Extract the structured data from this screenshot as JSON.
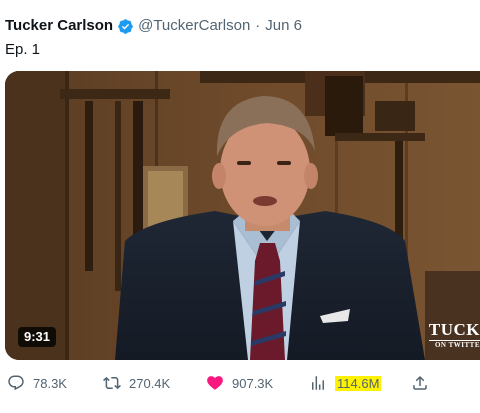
{
  "tweet": {
    "author_name": "Tucker Carlson",
    "handle": "@TuckerCarlson",
    "separator": "·",
    "date": "Jun 6",
    "text": "Ep. 1"
  },
  "media": {
    "duration": "9:31",
    "watermark_main": "TUCK",
    "watermark_sub": "ON TWITTE"
  },
  "actions": {
    "replies": "78.3K",
    "reposts": "270.4K",
    "likes": "907.3K",
    "views": "114.6M"
  },
  "colors": {
    "like_heart": "#f91880",
    "verified_badge": "#1d9bf0",
    "views_highlight": "#fff200",
    "secondary_text": "#536471"
  },
  "icons": [
    "verified-badge-icon",
    "reply-icon",
    "repost-icon",
    "like-icon",
    "views-icon",
    "share-icon"
  ]
}
